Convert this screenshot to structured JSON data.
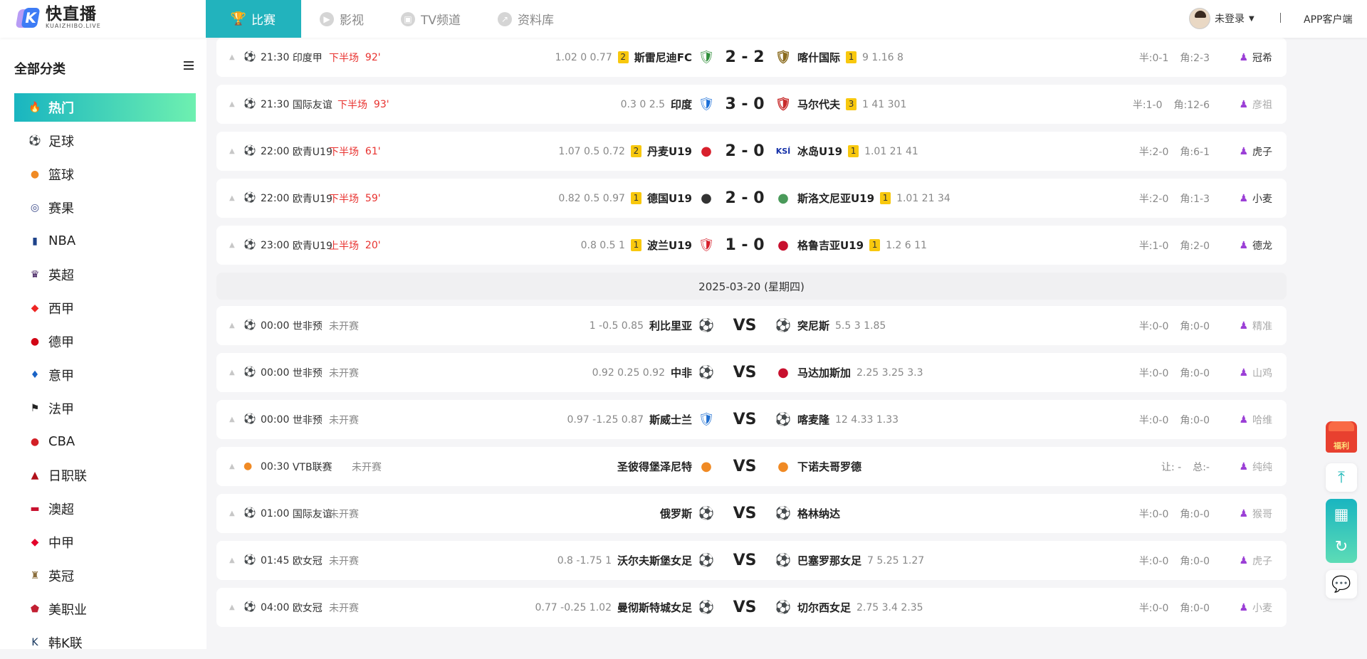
{
  "header": {
    "logo_cn": "快直播",
    "logo_en": "KUAIZHIBO.LIVE",
    "logo_letter": "K",
    "nav": [
      {
        "label": "比赛",
        "icon": "trophy-icon",
        "glyph": "🏆"
      },
      {
        "label": "影视",
        "icon": "play-icon",
        "glyph": "▶"
      },
      {
        "label": "TV频道",
        "icon": "tv-icon",
        "glyph": "▣"
      },
      {
        "label": "资料库",
        "icon": "chart-icon",
        "glyph": "↗"
      }
    ],
    "user_label": "未登录",
    "separator": "|",
    "app_link": "APP客户端"
  },
  "sidebar": {
    "title": "全部分类",
    "items": [
      {
        "label": "热门",
        "icon": "flame-icon",
        "glyph": "🔥",
        "color": "#ffffff"
      },
      {
        "label": "足球",
        "icon": "soccer-ball-icon",
        "glyph": "⚽",
        "color": "#222222"
      },
      {
        "label": "篮球",
        "icon": "basketball-icon",
        "glyph": "●",
        "color": "#f08a24"
      },
      {
        "label": "赛果",
        "icon": "results-icon",
        "glyph": "◎",
        "color": "#3b4a8a"
      },
      {
        "label": "NBA",
        "icon": "nba-logo-icon",
        "glyph": "▮",
        "color": "#1d428a"
      },
      {
        "label": "英超",
        "icon": "premier-league-icon",
        "glyph": "♛",
        "color": "#3d195b"
      },
      {
        "label": "西甲",
        "icon": "laliga-icon",
        "glyph": "◆",
        "color": "#ee2523"
      },
      {
        "label": "德甲",
        "icon": "bundesliga-icon",
        "glyph": "●",
        "color": "#d20515"
      },
      {
        "label": "意甲",
        "icon": "serie-a-icon",
        "glyph": "♦",
        "color": "#1a63c6"
      },
      {
        "label": "法甲",
        "icon": "ligue1-icon",
        "glyph": "⚑",
        "color": "#222222"
      },
      {
        "label": "CBA",
        "icon": "cba-icon",
        "glyph": "●",
        "color": "#d31f26"
      },
      {
        "label": "日职联",
        "icon": "j-league-icon",
        "glyph": "▲",
        "color": "#b0101a"
      },
      {
        "label": "澳超",
        "icon": "a-league-icon",
        "glyph": "▬",
        "color": "#c8102e"
      },
      {
        "label": "中甲",
        "icon": "china-league-icon",
        "glyph": "◆",
        "color": "#e4002b"
      },
      {
        "label": "英冠",
        "icon": "championship-icon",
        "glyph": "♜",
        "color": "#8a6d3b"
      },
      {
        "label": "美职业",
        "icon": "mls-icon",
        "glyph": "⬟",
        "color": "#c21f32"
      },
      {
        "label": "韩K联",
        "icon": "k-league-icon",
        "glyph": "K",
        "color": "#12335b"
      }
    ]
  },
  "date_divider": "2025-03-20 (星期四)",
  "matches": [
    {
      "sport": "soccer",
      "time": "21:30",
      "league": "印度甲",
      "status": "下半场",
      "minute": "92'",
      "live": true,
      "odds_home": "1.02  0  0.77",
      "rank_home": "2",
      "home": "斯雷尼迪FC",
      "home_badge": "🛡",
      "home_color": "#2f8f3a",
      "score": "2 - 2",
      "away": "喀什国际",
      "away_badge": "🛡",
      "away_color": "#8a6b1e",
      "rank_away": "1",
      "odds_away": "9  1.16  8",
      "half": "半:0-1",
      "corner": "角:2-3",
      "anchor": "冠希",
      "anchor_active": true
    },
    {
      "sport": "soccer",
      "time": "21:30",
      "league": "国际友谊",
      "status": "下半场",
      "minute": "93'",
      "live": true,
      "odds_home": "0.3  0  2.5",
      "rank_home": "",
      "home": "印度",
      "home_badge": "🛡",
      "home_color": "#1b6fd8",
      "score": "3 - 0",
      "away": "马尔代夫",
      "away_badge": "🛡",
      "away_color": "#c82b2b",
      "rank_away": "3",
      "odds_away": "1  41  301",
      "half": "半:1-0",
      "corner": "角:12-6",
      "anchor": "彦祖",
      "anchor_active": false
    },
    {
      "sport": "soccer",
      "time": "22:00",
      "league": "欧青U19",
      "status": "下半场",
      "minute": "61'",
      "live": true,
      "odds_home": "1.07  0.5  0.72",
      "rank_home": "2",
      "home": "丹麦U19",
      "home_badge": "●",
      "home_color": "#d8202c",
      "score": "2 - 0",
      "away": "冰岛U19",
      "away_badge": "KSÍ",
      "away_color": "#1430a8",
      "rank_away": "1",
      "odds_away": "1.01  21  41",
      "half": "半:2-0",
      "corner": "角:6-1",
      "anchor": "虎子",
      "anchor_active": true
    },
    {
      "sport": "soccer",
      "time": "22:00",
      "league": "欧青U19",
      "status": "下半场",
      "minute": "59'",
      "live": true,
      "odds_home": "0.82  0.5  0.97",
      "rank_home": "1",
      "home": "德国U19",
      "home_badge": "●",
      "home_color": "#333333",
      "score": "2 - 0",
      "away": "斯洛文尼亚U19",
      "away_badge": "●",
      "away_color": "#4a9a5a",
      "rank_away": "1",
      "odds_away": "1.01  21  34",
      "half": "半:2-0",
      "corner": "角:1-3",
      "anchor": "小麦",
      "anchor_active": true
    },
    {
      "sport": "soccer",
      "time": "23:00",
      "league": "欧青U19",
      "status": "上半场",
      "minute": "20'",
      "live": true,
      "odds_home": "0.8  0.5  1",
      "rank_home": "1",
      "home": "波兰U19",
      "home_badge": "🛡",
      "home_color": "#d61f2b",
      "score": "1 - 0",
      "away": "格鲁吉亚U19",
      "away_badge": "●",
      "away_color": "#c8102e",
      "rank_away": "1",
      "odds_away": "1.2  6  11",
      "half": "半:1-0",
      "corner": "角:2-0",
      "anchor": "德龙",
      "anchor_active": true
    },
    {
      "sport": "soccer",
      "time": "00:00",
      "league": "世非预",
      "status": "未开赛",
      "minute": "",
      "live": false,
      "odds_home": "1  -0.5  0.85",
      "rank_home": "",
      "home": "利比里亚",
      "home_badge": "⚽",
      "home_color": "#222222",
      "score": "VS",
      "away": "突尼斯",
      "away_badge": "⚽",
      "away_color": "#222222",
      "rank_away": "",
      "odds_away": "5.5  3  1.85",
      "half": "半:0-0",
      "corner": "角:0-0",
      "anchor": "精准",
      "anchor_active": false
    },
    {
      "sport": "soccer",
      "time": "00:00",
      "league": "世非预",
      "status": "未开赛",
      "minute": "",
      "live": false,
      "odds_home": "0.92  0.25  0.92",
      "rank_home": "",
      "home": "中非",
      "home_badge": "⚽",
      "home_color": "#222222",
      "score": "VS",
      "away": "马达加斯加",
      "away_badge": "●",
      "away_color": "#c8102e",
      "rank_away": "",
      "odds_away": "2.25  3.25  3.3",
      "half": "半:0-0",
      "corner": "角:0-0",
      "anchor": "山鸡",
      "anchor_active": false
    },
    {
      "sport": "soccer",
      "time": "00:00",
      "league": "世非预",
      "status": "未开赛",
      "minute": "",
      "live": false,
      "odds_home": "0.97  -1.25  0.87",
      "rank_home": "",
      "home": "斯威士兰",
      "home_badge": "🛡",
      "home_color": "#1f6fd0",
      "score": "VS",
      "away": "喀麦隆",
      "away_badge": "⚽",
      "away_color": "#222222",
      "rank_away": "",
      "odds_away": "12  4.33  1.33",
      "half": "半:0-0",
      "corner": "角:0-0",
      "anchor": "哈维",
      "anchor_active": false
    },
    {
      "sport": "basketball",
      "time": "00:30",
      "league": "VTB联赛",
      "status": "未开赛",
      "minute": "",
      "live": false,
      "odds_home": "",
      "rank_home": "",
      "home": "圣彼得堡泽尼特",
      "home_badge": "●",
      "home_color": "#f08a24",
      "score": "VS",
      "away": "下诺夫哥罗德",
      "away_badge": "●",
      "away_color": "#f08a24",
      "rank_away": "",
      "odds_away": "",
      "half": "让: -",
      "corner": "总:-",
      "anchor": "纯纯",
      "anchor_active": false
    },
    {
      "sport": "soccer",
      "time": "01:00",
      "league": "国际友谊",
      "status": "未开赛",
      "minute": "",
      "live": false,
      "odds_home": "",
      "rank_home": "",
      "home": "俄罗斯",
      "home_badge": "⚽",
      "home_color": "#222222",
      "score": "VS",
      "away": "格林纳达",
      "away_badge": "⚽",
      "away_color": "#222222",
      "rank_away": "",
      "odds_away": "",
      "half": "半:0-0",
      "corner": "角:0-0",
      "anchor": "猴哥",
      "anchor_active": false
    },
    {
      "sport": "soccer",
      "time": "01:45",
      "league": "欧女冠",
      "status": "未开赛",
      "minute": "",
      "live": false,
      "odds_home": "0.8  -1.75  1",
      "rank_home": "",
      "home": "沃尔夫斯堡女足",
      "home_badge": "⚽",
      "home_color": "#222222",
      "score": "VS",
      "away": "巴塞罗那女足",
      "away_badge": "⚽",
      "away_color": "#222222",
      "rank_away": "",
      "odds_away": "7  5.25  1.27",
      "half": "半:0-0",
      "corner": "角:0-0",
      "anchor": "虎子",
      "anchor_active": false
    },
    {
      "sport": "soccer",
      "time": "04:00",
      "league": "欧女冠",
      "status": "未开赛",
      "minute": "",
      "live": false,
      "odds_home": "0.77  -0.25  1.02",
      "rank_home": "",
      "home": "曼彻斯特城女足",
      "home_badge": "⚽",
      "home_color": "#222222",
      "score": "VS",
      "away": "切尔西女足",
      "away_badge": "⚽",
      "away_color": "#222222",
      "rank_away": "",
      "odds_away": "2.75  3.4  2.35",
      "half": "半:0-0",
      "corner": "角:0-0",
      "anchor": "小麦",
      "anchor_active": false
    }
  ],
  "floats": {
    "gift_label": "福利"
  }
}
